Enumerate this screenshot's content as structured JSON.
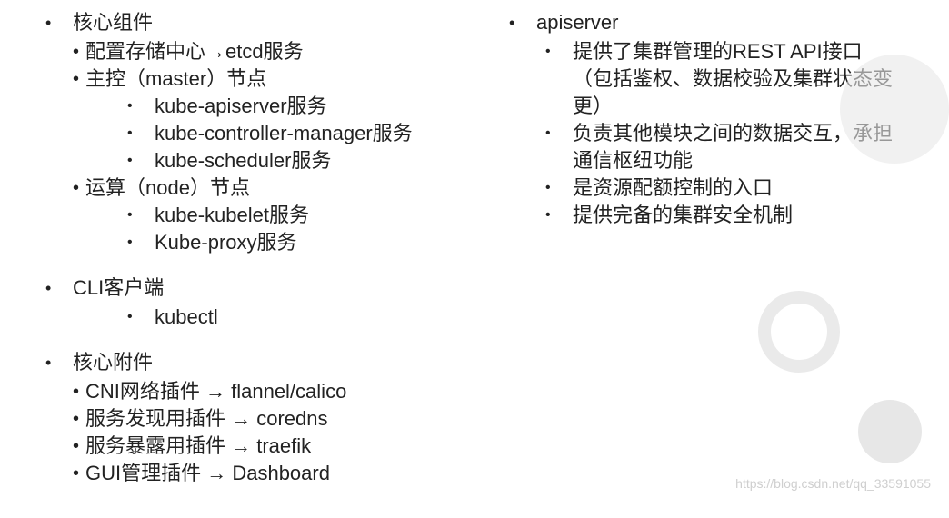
{
  "left": {
    "s1": {
      "title": "核心组件",
      "a": "配置存储中心→etcd服务",
      "b": "主控（master）节点",
      "b1": "kube-apiserver服务",
      "b2": "kube-controller-manager服务",
      "b3": "kube-scheduler服务",
      "c": "运算（node）节点",
      "c1": "kube-kubelet服务",
      "c2": "Kube-proxy服务"
    },
    "s2": {
      "title": "CLI客户端",
      "a": "kubectl"
    },
    "s3": {
      "title": "核心附件",
      "a": "CNI网络插件 → flannel/calico",
      "b": "服务发现用插件 → coredns",
      "c": "服务暴露用插件 → traefik",
      "d": "GUI管理插件 → Dashboard"
    }
  },
  "right": {
    "title": "apiserver",
    "a": "提供了集群管理的REST API接口（包括鉴权、数据校验及集群状态变更）",
    "b": "负责其他模块之间的数据交互，承担通信枢纽功能",
    "c": "是资源配额控制的入口",
    "d": "提供完备的集群安全机制"
  },
  "watermark": "https://blog.csdn.net/qq_33591055"
}
